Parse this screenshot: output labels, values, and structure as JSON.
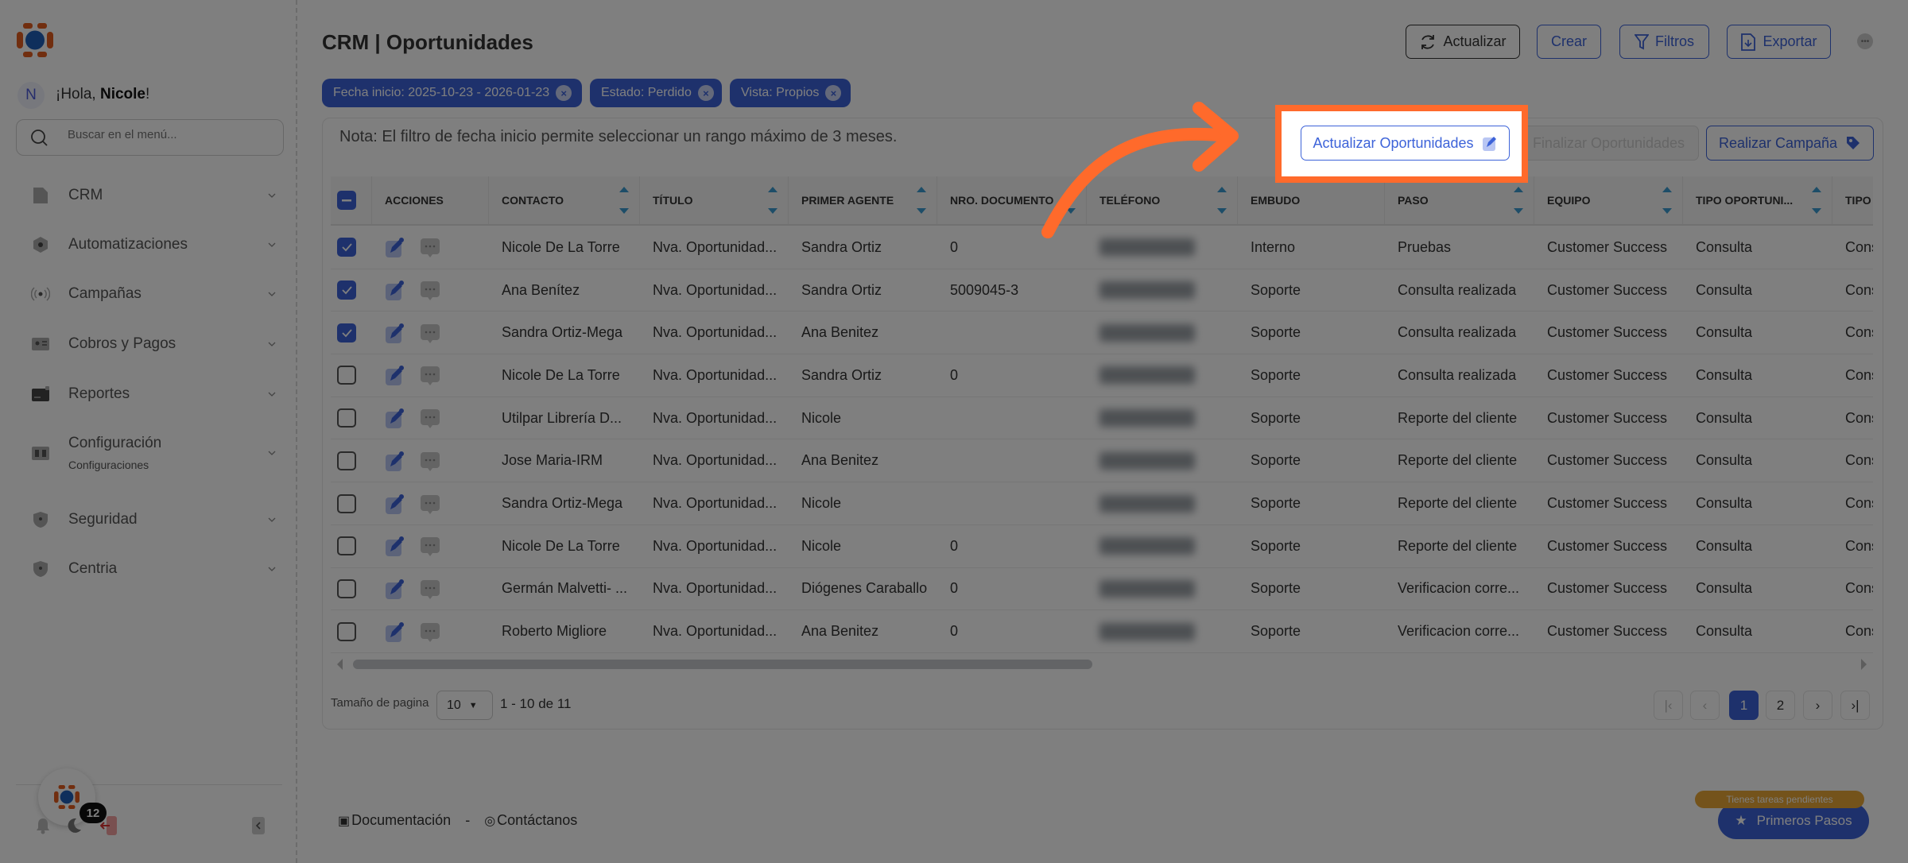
{
  "colors": {
    "accent": "#3d63d9",
    "highlight": "#ff6a2b",
    "pending": "#e8a737"
  },
  "sidebar": {
    "avatar_initial": "N",
    "greeting_prefix": "¡Hola, ",
    "greeting_name": "Nicole",
    "greeting_suffix": "!",
    "search_placeholder": "Buscar en el menú...",
    "items": [
      {
        "label": "CRM",
        "icon": "file-icon"
      },
      {
        "label": "Automatizaciones",
        "icon": "hexagon-icon"
      },
      {
        "label": "Campañas",
        "icon": "broadcast-icon"
      },
      {
        "label": "Cobros y Pagos",
        "icon": "id-card-icon"
      },
      {
        "label": "Reportes",
        "icon": "wallet-icon"
      },
      {
        "label": "Configuración",
        "sublabel": "Configuraciones",
        "icon": "book-icon"
      },
      {
        "label": "Seguridad",
        "icon": "shield-icon"
      },
      {
        "label": "Centria",
        "icon": "shield-icon"
      }
    ],
    "notification_count": "12"
  },
  "header": {
    "title": "CRM | Oportunidades",
    "buttons": {
      "refresh": "Actualizar",
      "create": "Crear",
      "filters": "Filtros",
      "export": "Exportar"
    }
  },
  "filters": [
    {
      "label": "Fecha inicio: 2025-10-23 - 2026-01-23"
    },
    {
      "label": "Estado: Perdido"
    },
    {
      "label": "Vista: Propios"
    }
  ],
  "note": "Nota: El filtro de fecha inicio permite seleccionar un rango máximo de 3 meses.",
  "actions": {
    "update": "Actualizar Oportunidades",
    "finish": "Finalizar Oportunidades",
    "campaign": "Realizar Campaña"
  },
  "table": {
    "columns": [
      "ACCIONES",
      "CONTACTO",
      "TÍTULO",
      "PRIMER AGENTE",
      "NRO. DOCUMENTO",
      "TELÉFONO",
      "EMBUDO",
      "PASO",
      "EQUIPO",
      "TIPO OPORTUNI...",
      "TIPO C"
    ],
    "rows": [
      {
        "checked": true,
        "contacto": "Nicole De La Torre",
        "titulo": "Nva. Oportunidad...",
        "agente": "Sandra Ortiz",
        "doc": "0",
        "embudo": "Interno",
        "paso": "Pruebas",
        "equipo": "Customer Success",
        "tipo": "Consulta",
        "tipo2": "Cons"
      },
      {
        "checked": true,
        "contacto": "Ana Benítez",
        "titulo": "Nva. Oportunidad...",
        "agente": "Sandra Ortiz",
        "doc": "5009045-3",
        "embudo": "Soporte",
        "paso": "Consulta realizada",
        "equipo": "Customer Success",
        "tipo": "Consulta",
        "tipo2": "Cons"
      },
      {
        "checked": true,
        "contacto": "Sandra Ortiz-Mega",
        "titulo": "Nva. Oportunidad...",
        "agente": "Ana Benitez",
        "doc": "",
        "embudo": "Soporte",
        "paso": "Consulta realizada",
        "equipo": "Customer Success",
        "tipo": "Consulta",
        "tipo2": "Cons"
      },
      {
        "checked": false,
        "contacto": "Nicole De La Torre",
        "titulo": "Nva. Oportunidad...",
        "agente": "Sandra Ortiz",
        "doc": "0",
        "embudo": "Soporte",
        "paso": "Consulta realizada",
        "equipo": "Customer Success",
        "tipo": "Consulta",
        "tipo2": "Cons"
      },
      {
        "checked": false,
        "contacto": "Utilpar Librería D...",
        "titulo": "Nva. Oportunidad...",
        "agente": "Nicole",
        "doc": "",
        "embudo": "Soporte",
        "paso": "Reporte del cliente",
        "equipo": "Customer Success",
        "tipo": "Consulta",
        "tipo2": "Cons"
      },
      {
        "checked": false,
        "contacto": "Jose Maria-IRM",
        "titulo": "Nva. Oportunidad...",
        "agente": "Ana Benitez",
        "doc": "",
        "embudo": "Soporte",
        "paso": "Reporte del cliente",
        "equipo": "Customer Success",
        "tipo": "Consulta",
        "tipo2": "Cons"
      },
      {
        "checked": false,
        "contacto": "Sandra Ortiz-Mega",
        "titulo": "Nva. Oportunidad...",
        "agente": "Nicole",
        "doc": "",
        "embudo": "Soporte",
        "paso": "Reporte del cliente",
        "equipo": "Customer Success",
        "tipo": "Consulta",
        "tipo2": "Cons"
      },
      {
        "checked": false,
        "contacto": "Nicole De La Torre",
        "titulo": "Nva. Oportunidad...",
        "agente": "Nicole",
        "doc": "0",
        "embudo": "Soporte",
        "paso": "Reporte del cliente",
        "equipo": "Customer Success",
        "tipo": "Consulta",
        "tipo2": "Cons"
      },
      {
        "checked": false,
        "contacto": "Germán Malvetti- ...",
        "titulo": "Nva. Oportunidad...",
        "agente": "Diógenes Caraballo",
        "doc": "0",
        "embudo": "Soporte",
        "paso": "Verificacion corre...",
        "equipo": "Customer Success",
        "tipo": "Consulta",
        "tipo2": "Cons"
      },
      {
        "checked": false,
        "contacto": "Roberto Migliore",
        "titulo": "Nva. Oportunidad...",
        "agente": "Ana Benitez",
        "doc": "0",
        "embudo": "Soporte",
        "paso": "Verificacion corre...",
        "equipo": "Customer Success",
        "tipo": "Consulta",
        "tipo2": "Cons"
      }
    ]
  },
  "pagination": {
    "page_size_label": "Tamaño de pagina",
    "page_size": "10",
    "range": "1 - 10 de 11",
    "pages": [
      "1",
      "2"
    ],
    "current": "1"
  },
  "footer": {
    "docs": "Documentación",
    "sep": "-",
    "contact": "Contáctanos"
  },
  "onboarding": {
    "pending": "Tienes tareas pendientes",
    "label": "Primeros Pasos"
  }
}
